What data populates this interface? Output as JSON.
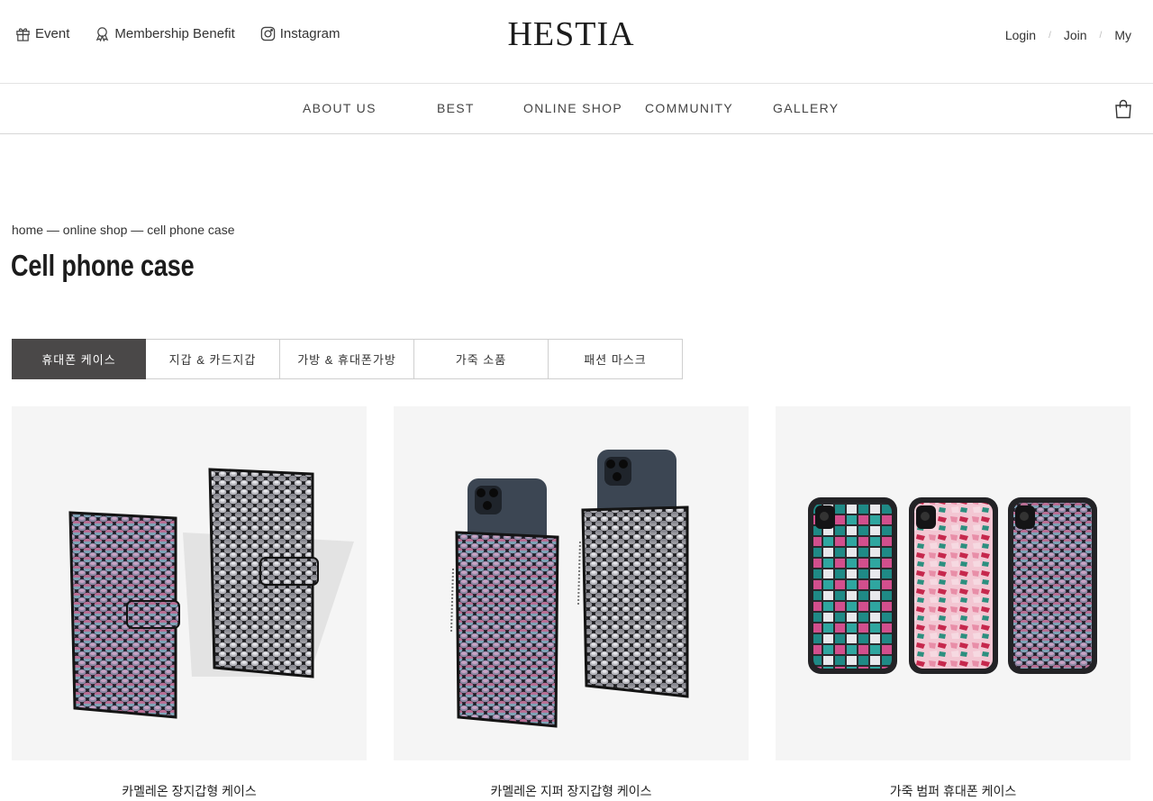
{
  "header": {
    "top_links": [
      {
        "label": "Event",
        "icon": "gift-icon"
      },
      {
        "label": "Membership Benefit",
        "icon": "award-icon"
      },
      {
        "label": "Instagram",
        "icon": "instagram-icon"
      }
    ],
    "logo": "HESTIA",
    "account": {
      "login": "Login",
      "join": "Join",
      "my": "My",
      "separator": "/"
    }
  },
  "nav": {
    "items": [
      "ABOUT US",
      "BEST",
      "ONLINE SHOP",
      "COMMUNITY",
      "GALLERY"
    ],
    "cart_icon": "shopping-bag-icon"
  },
  "breadcrumb": "home — online shop — cell phone case",
  "page_title": "Cell phone case",
  "category_tabs": [
    {
      "label": "휴대폰 케이스",
      "active": true
    },
    {
      "label": "지갑 & 카드지갑",
      "active": false
    },
    {
      "label": "가방 & 휴대폰가방",
      "active": false
    },
    {
      "label": "가죽 소품",
      "active": false
    },
    {
      "label": "패션 마스크",
      "active": false
    }
  ],
  "products": [
    {
      "name": "카멜레온 장지갑형 케이스"
    },
    {
      "name": "카멜레온 지퍼 장지갑형 케이스"
    },
    {
      "name": "가죽 범퍼 휴대폰 케이스"
    }
  ],
  "colors": {
    "active_tab": "#4a4848",
    "image_bg": "#f5f5f5",
    "text": "#222222"
  }
}
